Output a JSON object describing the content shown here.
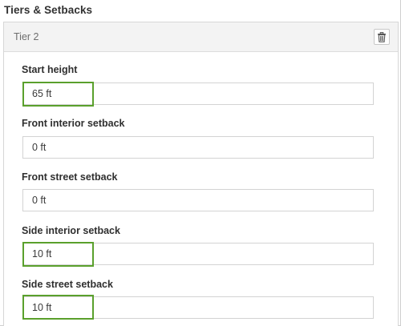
{
  "section": {
    "title": "Tiers & Setbacks"
  },
  "tier": {
    "title": "Tier 2",
    "delete_icon": "trash-icon"
  },
  "fields": [
    {
      "label": "Start height",
      "value": "65 ft",
      "highlighted": true
    },
    {
      "label": "Front interior setback",
      "value": "0 ft",
      "highlighted": false
    },
    {
      "label": "Front street setback",
      "value": "0 ft",
      "highlighted": false
    },
    {
      "label": "Side interior setback",
      "value": "10 ft",
      "highlighted": true
    },
    {
      "label": "Side street setback",
      "value": "10 ft",
      "highlighted": true
    }
  ],
  "colors": {
    "highlight": "#5aa02c",
    "header_background": "#f3f3f3",
    "input_border": "#d3d3d3"
  }
}
